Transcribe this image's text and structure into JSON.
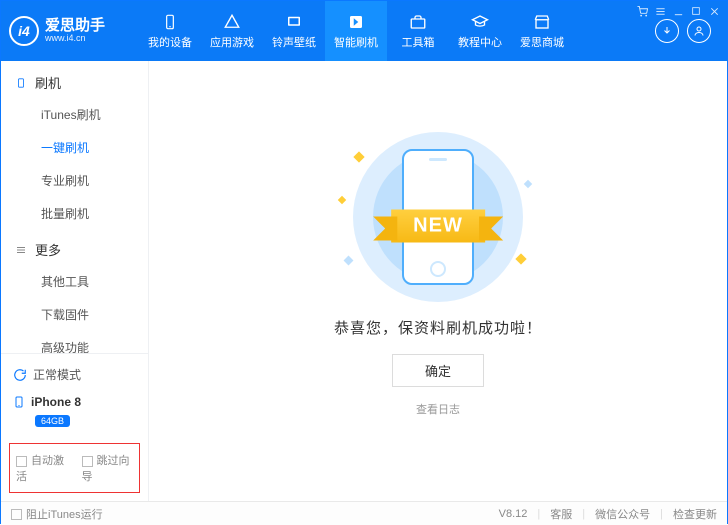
{
  "header": {
    "brand_name": "爱思助手",
    "brand_sub": "www.i4.cn",
    "tabs": [
      {
        "label": "我的设备"
      },
      {
        "label": "应用游戏"
      },
      {
        "label": "铃声壁纸"
      },
      {
        "label": "智能刷机"
      },
      {
        "label": "工具箱"
      },
      {
        "label": "教程中心"
      },
      {
        "label": "爱思商城"
      }
    ]
  },
  "sidebar": {
    "sections": [
      {
        "title": "刷机",
        "items": [
          "iTunes刷机",
          "一键刷机",
          "专业刷机",
          "批量刷机"
        ]
      },
      {
        "title": "更多",
        "items": [
          "其他工具",
          "下载固件",
          "高级功能"
        ]
      }
    ],
    "mode_label": "正常模式",
    "device_name": "iPhone 8",
    "device_storage": "64GB",
    "checks": {
      "auto_activate": "自动激活",
      "skip_guide": "跳过向导"
    }
  },
  "main": {
    "ribbon_text": "NEW",
    "message": "恭喜您，保资料刷机成功啦！",
    "ok_label": "确定",
    "log_label": "查看日志"
  },
  "footer": {
    "block_itunes": "阻止iTunes运行",
    "version": "V8.12",
    "support": "客服",
    "wechat": "微信公众号",
    "update": "检查更新"
  }
}
